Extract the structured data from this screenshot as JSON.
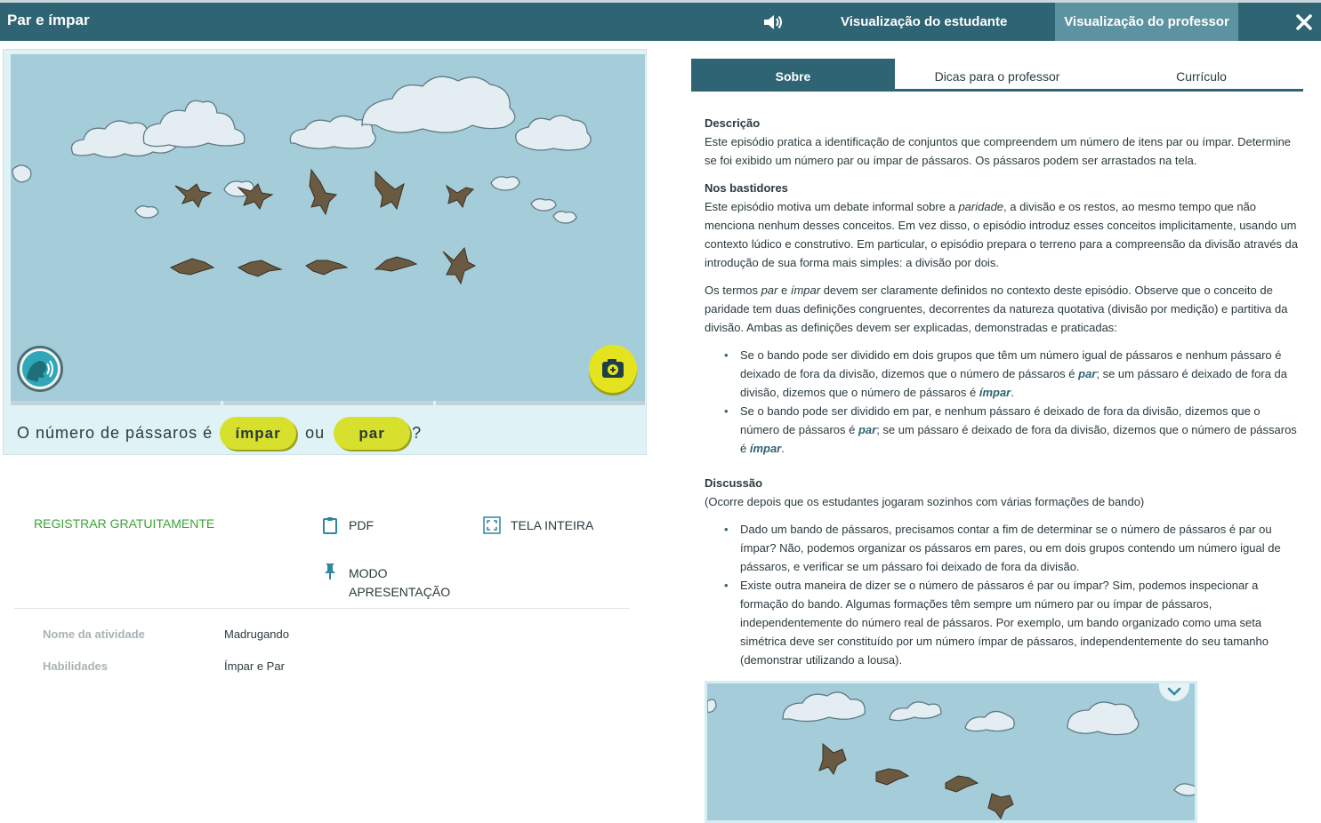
{
  "header": {
    "title": "Par e ímpar",
    "student_view": "Visualização do estudante",
    "teacher_view": "Visualização do professor"
  },
  "game": {
    "question_prefix": "O número de pássaros é",
    "option_odd": "ímpar",
    "connector": "ou",
    "option_even": "par",
    "question_suffix": "?"
  },
  "actions": {
    "register": "REGISTRAR GRATUITAMENTE",
    "pdf": "PDF",
    "fullscreen": "TELA INTEIRA",
    "presentation": "MODO APRESENTAÇÃO"
  },
  "meta": {
    "activity_label": "Nome da atividade",
    "activity_value": "Madrugando",
    "skills_label": "Habilidades",
    "skills_value": "Ímpar e Par"
  },
  "tabs": [
    "Sobre",
    "Dicas para o professor",
    "Currículo"
  ],
  "content": {
    "desc_title": "Descrição",
    "desc_text": "Este episódio pratica a identificação de conjuntos que compreendem um número de itens par ou ímpar. Determine se foi exibido um número par ou ímpar de pássaros. Os pássaros podem ser arrastados na tela.",
    "behind_title": "Nos bastidores",
    "behind_1a": "Este episódio motiva um debate informal sobre a ",
    "behind_1b": "paridade",
    "behind_1c": ", a divisão e os restos, ao mesmo tempo que não menciona nenhum desses conceitos. Em vez disso, o episódio introduz esses conceitos implicitamente, usando um contexto lúdico e construtivo. Em particular, o episódio prepara o terreno para a compreensão da divisão através da introdução de sua forma mais simples: a divisão por dois.",
    "behind_2a": "Os termos ",
    "behind_2b": "par",
    "behind_2c": " e ",
    "behind_2d": "ímpar",
    "behind_2e": " devem ser claramente definidos no contexto deste episódio. Observe que o conceito de paridade tem duas definições congruentes, decorrentes da natureza quotativa (divisão por medição) e partitiva da divisão. Ambas as definições devem ser explicadas, demonstradas e praticadas:",
    "b1a": "Se o bando pode ser dividido em dois grupos que têm um número igual de pássaros e nenhum pássaro é deixado de fora da divisão, dizemos que o número de pássaros é ",
    "b1b": "par",
    "b1c": "; se um pássaro é deixado de fora da divisão, dizemos que o número de pássaros é ",
    "b1d": "ímpar",
    "b1e": ".",
    "b2a": "Se o bando pode ser dividido em par, e nenhum pássaro é deixado de fora da divisão, dizemos que o número de pássaros é ",
    "b2b": "par",
    "b2c": "; se um pássaro é deixado de fora da divisão, dizemos que o número de pássaros é ",
    "b2d": "ímpar",
    "b2e": ".",
    "disc_title": "Discussão",
    "disc_sub": "(Ocorre depois que os estudantes jogaram sozinhos com várias formações de bando)",
    "d1": "Dado um bando de pássaros, precisamos contar a fim de determinar se o número de pássaros é par ou ímpar? Não, podemos organizar os pássaros em pares, ou em dois grupos contendo um número igual de pássaros, e verificar se um pássaro foi deixado de fora da divisão.",
    "d2": "Existe outra maneira de dizer se o número de pássaros é par ou ímpar? Sim, podemos inspecionar a formação do bando. Algumas formações têm sempre um número par ou ímpar de pássaros, independentemente do número real de pássaros. Por exemplo, um bando organizado como uma seta simétrica deve ser constituído por um número ímpar de pássaros, independentemente do seu tamanho (demonstrar utilizando a lousa)."
  },
  "colors": {
    "header": "#2e6473",
    "active_tab": "#5d93a0",
    "sky": "#a4cdd9",
    "answer_button": "#d8e02e",
    "register_link": "#3aa435"
  }
}
